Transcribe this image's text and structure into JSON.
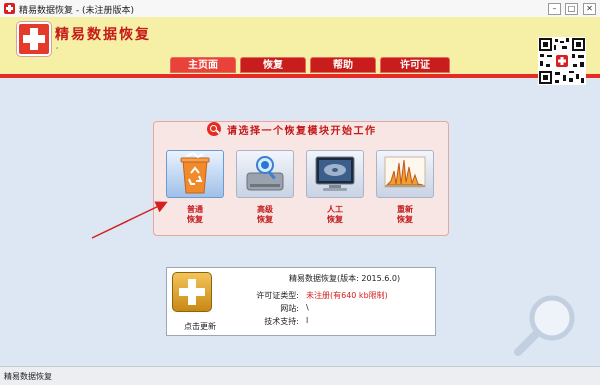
{
  "window": {
    "title": "精易数据恢复 - (未注册版本)",
    "controls": {
      "minimize": "–",
      "maximize": "□",
      "close": "✕"
    }
  },
  "header": {
    "brand_title": "精易数据恢复",
    "brand_sub": ",",
    "tabs": [
      {
        "label": "主页面",
        "active": true
      },
      {
        "label": "恢复",
        "active": false
      },
      {
        "label": "帮助",
        "active": false
      },
      {
        "label": "许可证",
        "active": false
      }
    ]
  },
  "modules_panel": {
    "title": "请选择一个恢复模块开始工作",
    "modules": [
      {
        "line1": "普通",
        "line2": "恢复",
        "icon": "recycle-bin-icon"
      },
      {
        "line1": "高级",
        "line2": "恢复",
        "icon": "hard-drive-search-icon"
      },
      {
        "line1": "人工",
        "line2": "恢复",
        "icon": "monitor-disk-icon"
      },
      {
        "line1": "重新",
        "line2": "恢复",
        "icon": "chart-signal-icon"
      }
    ]
  },
  "info": {
    "title": "精易数据恢复(版本: 2015.6.0)",
    "update_label": "点击更新",
    "rows": [
      {
        "key": "许可证类型:",
        "value": "未注册(有640 kb限制)"
      },
      {
        "key": "网站:",
        "value": "\\"
      },
      {
        "key": "技术支持:",
        "value": "l"
      }
    ]
  },
  "status": {
    "text": "精易数据恢复"
  },
  "colors": {
    "accent_red": "#e52c24",
    "header_yellow": "#f6f0a6",
    "background": "#dde7f4"
  }
}
